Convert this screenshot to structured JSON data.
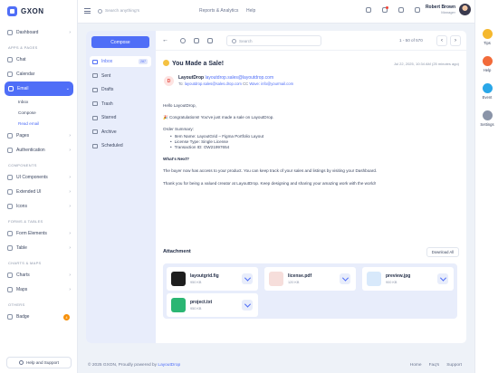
{
  "brand": {
    "name": "GXON"
  },
  "sidebar": {
    "items": [
      {
        "label": "Dashboard",
        "icon": "home-icon",
        "chevron": "›"
      },
      {
        "section": "APPS & PAGES"
      },
      {
        "label": "Chat",
        "icon": "chat-icon"
      },
      {
        "label": "Calendar",
        "icon": "calendar-icon"
      },
      {
        "label": "Email",
        "icon": "mail-icon",
        "chevron": "⌄",
        "active": true
      },
      {
        "sub": "Inbox"
      },
      {
        "sub": "Compose"
      },
      {
        "sub": "Read email",
        "current": true
      },
      {
        "label": "Pages",
        "icon": "file-icon",
        "chevron": "›"
      },
      {
        "label": "Authentication",
        "icon": "lock-icon",
        "chevron": "›"
      },
      {
        "section": "COMPONENTS"
      },
      {
        "label": "UI Components",
        "icon": "box-icon",
        "chevron": "›"
      },
      {
        "label": "Extended UI",
        "icon": "layers-icon",
        "chevron": "›"
      },
      {
        "label": "Icons",
        "icon": "star-icon",
        "chevron": "›"
      },
      {
        "section": "FORMS & TABLES"
      },
      {
        "label": "Form Elements",
        "icon": "form-icon",
        "chevron": "›"
      },
      {
        "label": "Table",
        "icon": "table-icon",
        "chevron": "›"
      },
      {
        "section": "CHARTS & MAPS"
      },
      {
        "label": "Charts",
        "icon": "chart-icon",
        "chevron": "›"
      },
      {
        "label": "Maps",
        "icon": "map-icon",
        "chevron": "›"
      },
      {
        "section": "OTHERS"
      },
      {
        "label": "Badge",
        "icon": "badge-icon",
        "badge": "4"
      }
    ],
    "help_label": "Help and Support"
  },
  "topbar": {
    "search_placeholder": "Search anything's",
    "links": [
      "Reports & Analytics",
      "Help"
    ],
    "user_name": "Robert Brown",
    "user_role": "Manager"
  },
  "rail": [
    {
      "label": "Tips",
      "color": "#f5b82e"
    },
    {
      "label": "Help",
      "color": "#f26b3a"
    },
    {
      "label": "Event",
      "color": "#2aa7e8"
    },
    {
      "label": "Settings",
      "color": "#8a94a8"
    }
  ],
  "mail": {
    "compose_label": "Compose",
    "folders": [
      {
        "label": "Inbox",
        "count": "287",
        "active": true
      },
      {
        "label": "Sent"
      },
      {
        "label": "Drafts"
      },
      {
        "label": "Trash"
      },
      {
        "label": "Starred"
      },
      {
        "label": "Archive"
      },
      {
        "label": "Scheduled"
      }
    ],
    "search_placeholder": "Search",
    "pager": "1 - 50 of 570",
    "subject": "You Made a Sale!",
    "date": "Jul 22, 2025, 10:34 AM (25 minutes ago)",
    "sender_initial": "D",
    "sender_name": "LayoutDrop",
    "sender_email": "layoutdrop.sales@layoutdrop.com",
    "to_label": "To:",
    "to_email": "layoutdrop.sales@sales.drop.com",
    "cc_label": "CC",
    "cc_value": "Wave: info@yourmail.com",
    "greeting": "Hello LayoutDrop,",
    "congrats": "🎉 Congratulations! You've just made a sale on LayoutDrop.",
    "order_title": "Order Summary:",
    "order_items": [
      "Item Name: LayoutGrid – Figma Portfolio Layout",
      "License Type: Single License",
      "Transaction ID: OW21997654"
    ],
    "next_title": "What's Next?",
    "next_text": "The buyer now has access to your product. You can keep track of your sales and listings by visiting your Dashboard.",
    "thanks": "Thank you for being a valued creator at LayoutDrop. Keep designing and sharing your amazing work with the world!",
    "attachment_title": "Attachment",
    "download_all": "Download All",
    "attachments": [
      {
        "name": "layoutgrid.fig",
        "size": "950 KB",
        "icon": "figma-file-icon",
        "color": "#1e1e1e"
      },
      {
        "name": "license.pdf",
        "size": "120 KB",
        "icon": "pdf-file-icon",
        "color": "#f6dedb"
      },
      {
        "name": "preview.jpg",
        "size": "900 KB",
        "icon": "image-file-icon",
        "color": "#d8e9fb"
      },
      {
        "name": "project.txt",
        "size": "950 KB",
        "icon": "text-file-icon",
        "color": "#2bb673"
      }
    ]
  },
  "footer": {
    "copyright": "© 2025 GXON, Proudly powered by",
    "link": "LayoutDrop",
    "links": [
      "Home",
      "Faq's",
      "Support"
    ]
  }
}
